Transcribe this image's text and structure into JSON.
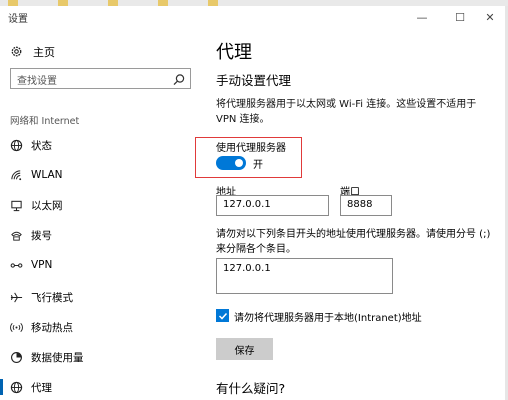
{
  "window": {
    "title": "设置",
    "minimize_glyph": "—",
    "maximize_glyph": "☐",
    "close_glyph": "✕"
  },
  "sidebar": {
    "home_label": "主页",
    "search_placeholder": "查找设置",
    "section_title": "网络和 Internet",
    "items": [
      {
        "label": "状态",
        "icon": "globe-icon"
      },
      {
        "label": "WLAN",
        "icon": "wifi-icon"
      },
      {
        "label": "以太网",
        "icon": "ethernet-icon"
      },
      {
        "label": "拨号",
        "icon": "dialup-icon"
      },
      {
        "label": "VPN",
        "icon": "vpn-icon"
      },
      {
        "label": "飞行模式",
        "icon": "airplane-icon"
      },
      {
        "label": "移动热点",
        "icon": "hotspot-icon"
      },
      {
        "label": "数据使用量",
        "icon": "data-usage-icon"
      },
      {
        "label": "代理",
        "icon": "globe-icon",
        "active": true
      }
    ]
  },
  "main": {
    "title": "代理",
    "manual_title": "手动设置代理",
    "description": "将代理服务器用于以太网或 Wi-Fi 连接。这些设置不适用于 VPN 连接。",
    "toggle_label": "使用代理服务器",
    "toggle_state": "开",
    "address_label": "地址",
    "address_value": "127.0.0.1",
    "port_label": "端口",
    "port_value": "8888",
    "exceptions_desc": "请勿对以下列条目开头的地址使用代理服务器。请使用分号 (;) 来分隔各个条目。",
    "exceptions_value": "127.0.0.1",
    "local_checkbox_label": "请勿将代理服务器用于本地(Intranet)地址",
    "save_label": "保存",
    "questions_title": "有什么疑问?"
  },
  "colors": {
    "accent": "#0078d7",
    "highlight": "#e03a3a"
  }
}
